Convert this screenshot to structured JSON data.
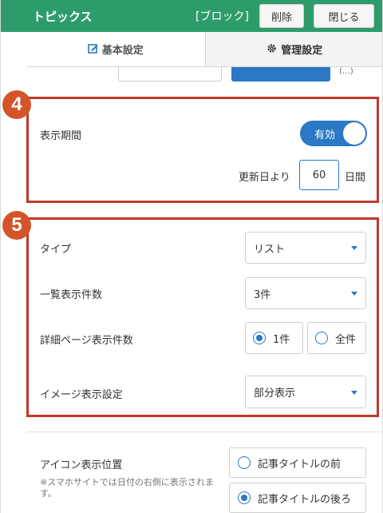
{
  "header": {
    "title": "トピックス",
    "block_label": "[ブロック]",
    "delete_label": "削除",
    "close_label": "閉じる",
    "bg_color": "#2e9c6a"
  },
  "tabs": [
    {
      "label": "基本設定",
      "icon": "edit-icon",
      "active": true
    },
    {
      "label": "管理設定",
      "icon": "gear-icon",
      "active": false
    }
  ],
  "partial_text": "(…)",
  "badges": {
    "section4": "4",
    "section5": "5"
  },
  "display_period": {
    "label": "表示期間",
    "toggle_label": "有効",
    "toggle_on": true,
    "prefix": "更新日より",
    "value": "60",
    "suffix": "日間"
  },
  "type_setting": {
    "label": "タイプ",
    "value": "リスト"
  },
  "list_count": {
    "label": "一覧表示件数",
    "value": "3件"
  },
  "detail_count": {
    "label": "詳細ページ表示件数",
    "options": [
      {
        "label": "1件",
        "selected": true
      },
      {
        "label": "全件",
        "selected": false
      }
    ]
  },
  "image_setting": {
    "label": "イメージ表示設定",
    "value": "部分表示"
  },
  "icon_position": {
    "label": "アイコン表示位置",
    "note": "※スマホサイトでは日付の右側に表示されます。",
    "options": [
      {
        "label": "記事タイトルの前",
        "selected": false
      },
      {
        "label": "記事タイトルの後ろ",
        "selected": true
      }
    ]
  },
  "accent_color": "#2b78c5",
  "highlight_color": "#c0392b"
}
